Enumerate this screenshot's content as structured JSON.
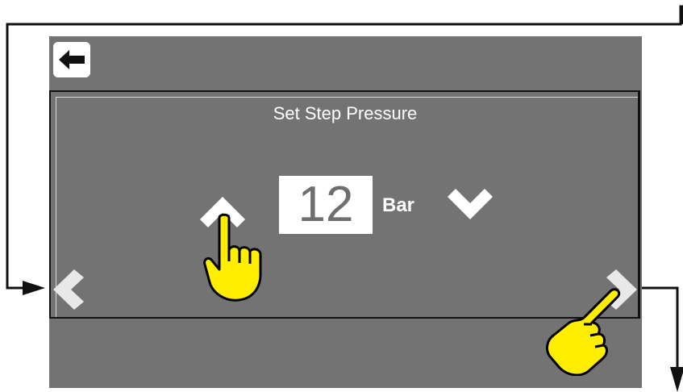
{
  "screen": {
    "title": "Set Step Pressure",
    "value": "12",
    "unit": "Bar"
  },
  "icons": {
    "back": "back-arrow-icon",
    "increase": "chevron-up-icon",
    "decrease": "chevron-down-icon",
    "previous": "chevron-left-icon",
    "next": "chevron-right-icon",
    "hand": "pointing-hand-icon"
  },
  "colors": {
    "screen_background": "#737373",
    "value_box": "#ffffff",
    "hand_fill": "#ffee00",
    "hand_outline": "#000000"
  }
}
